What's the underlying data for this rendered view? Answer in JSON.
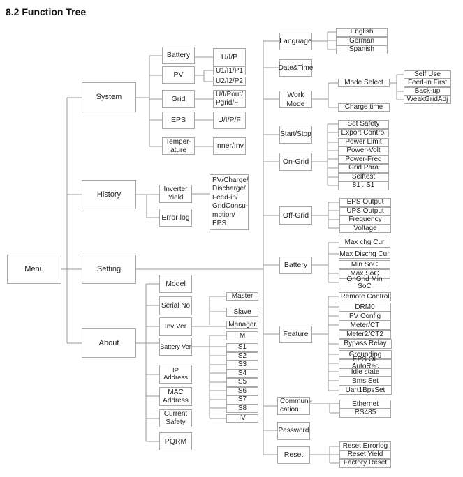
{
  "title": "8.2 Function Tree",
  "menu": "Menu",
  "system": {
    "label": "System",
    "battery": "Battery",
    "battery_values": "U/I/P",
    "pv": "PV",
    "pv_values": [
      "U1/I1/P1",
      "U2/I2/P2"
    ],
    "grid": "Grid",
    "grid_values": "U/I/Pout/\nPgrid/F",
    "eps": "EPS",
    "eps_values": "U/I/P/F",
    "temperature": "Temper-\nature",
    "temperature_values": "Inner/Inv"
  },
  "history": {
    "label": "History",
    "inverter_yield": "Inverter\nYield",
    "yield_values": "PV/Charge/\nDischarge/\nFeed-in/\nGridConsu-\nmption/\nEPS",
    "error_log": "Error log"
  },
  "setting": {
    "label": "Setting",
    "language": {
      "label": "Language",
      "options": [
        "English",
        "German",
        "Spanish"
      ]
    },
    "date_time": "Date&Time",
    "work_mode": {
      "label": "Work\nMode",
      "mode_select": "Mode Select",
      "modes": [
        "Self Use",
        "Feed-in First",
        "Back-up",
        "WeakGridAdj"
      ],
      "charge_time": "Charge time"
    },
    "start_stop": "Start/Stop",
    "on_grid": {
      "label": "On-Grid",
      "items": [
        "Set Safety",
        "Export Control",
        "Power Limit",
        "Power-Volt",
        "Power-Freq",
        "Grid Para",
        "Selftest",
        "81 . S1"
      ]
    },
    "off_grid": {
      "label": "Off-Grid",
      "items": [
        "EPS Output",
        "UPS Output",
        "Frequency",
        "Voltage"
      ]
    },
    "battery": {
      "label": "Battery",
      "items": [
        "Max chg Cur",
        "Max Dischg Cur",
        "Min SoC",
        "Max SoC",
        "OnGrid Min SoC"
      ]
    },
    "feature": {
      "label": "Feature",
      "items": [
        "Remote Control",
        "DRM0",
        "PV Config",
        "Meter/CT",
        "Meter2/CT2",
        "Bypass Relay",
        "Grounding",
        "EPS OL AutoRec",
        "Idle state",
        "Bms Set",
        "Uart1BpsSet"
      ]
    },
    "communication": {
      "label": "Communi-\ncation",
      "items": [
        "Ethernet",
        "RS485"
      ]
    },
    "password": "Password",
    "reset": {
      "label": "Reset",
      "items": [
        "Reset Errorlog",
        "Reset Yield",
        "Factory Reset"
      ]
    }
  },
  "about": {
    "label": "About",
    "model": "Model",
    "serial_no": "Serial No",
    "inv_ver": {
      "label": "Inv Ver",
      "items": [
        "Master",
        "Slave",
        "Manager"
      ]
    },
    "battery_ver": {
      "label": "Battery Ver",
      "items": [
        "M",
        "S1",
        "S2",
        "S3",
        "S4",
        "S5",
        "S6",
        "S7",
        "S8",
        "IV"
      ]
    },
    "ip_address": "IP Address",
    "mac_address": "MAC\nAddress",
    "current_safety": "Current\nSafety",
    "pqrm": "PQRM"
  }
}
